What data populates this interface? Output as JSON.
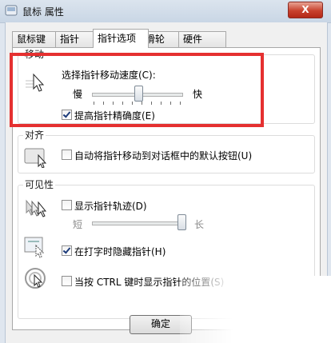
{
  "window": {
    "title": "鼠标 属性",
    "close_label": "X"
  },
  "tabs": [
    {
      "label": "鼠标键"
    },
    {
      "label": "指针"
    },
    {
      "label": "指针选项"
    },
    {
      "label": "滑轮"
    },
    {
      "label": "硬件"
    }
  ],
  "active_tab": "指针选项",
  "motion": {
    "group_label": "移动",
    "speed_label": "选择指针移动速度(C):",
    "slow_label": "慢",
    "fast_label": "快",
    "speed_value_fraction": 0.5,
    "enhance_precision": {
      "label": "提高指针精确度(E)",
      "checked": true
    }
  },
  "snap_to": {
    "group_label": "对齐",
    "auto_snap": {
      "label": "自动将指针移动到对话框中的默认按钮(U)",
      "checked": false
    }
  },
  "visibility": {
    "group_label": "可见性",
    "trails": {
      "label": "显示指针轨迹(D)",
      "checked": false,
      "short_label": "短",
      "long_label": "长",
      "length_fraction": 1.0
    },
    "hide_typing": {
      "label": "在打字时隐藏指针(H)",
      "checked": true
    },
    "show_ctrl": {
      "label": "当按 CTRL 键时显示指针的位置(S)",
      "checked": false
    }
  },
  "buttons": {
    "ok_label": "确定"
  },
  "colors": {
    "highlight_box": "#e53030",
    "close_button": "#c8412d"
  }
}
